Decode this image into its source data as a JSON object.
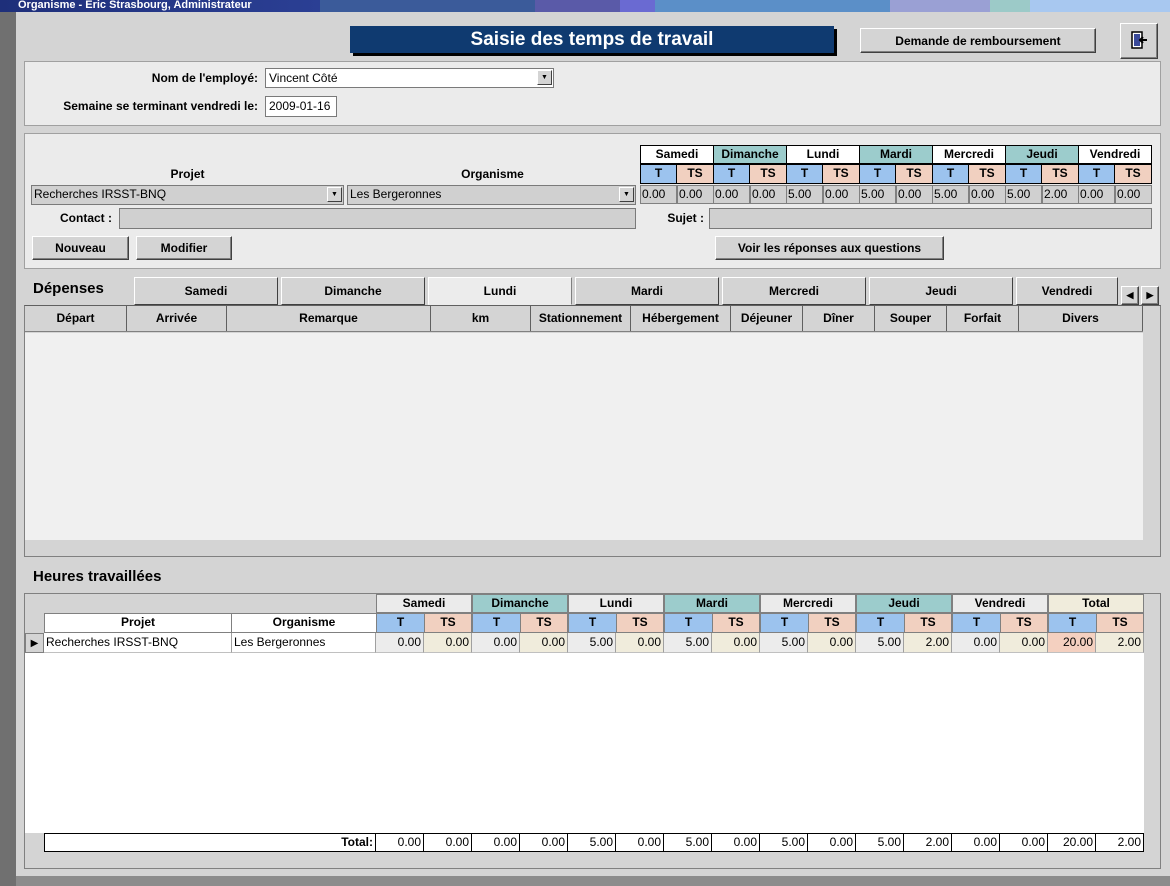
{
  "window": {
    "title": "Organisme - Eric Strasbourg, Administrateur"
  },
  "header": {
    "form_title": "Saisie des temps de travail",
    "reimburse_button": "Demande de remboursement",
    "exit_icon": "exit-door-icon"
  },
  "employee": {
    "label": "Nom de l'employé:",
    "value": "Vincent Côté",
    "week_label": "Semaine se terminant vendredi le:",
    "week_value": "2009-01-16"
  },
  "entry": {
    "projet_label": "Projet",
    "organisme_label": "Organisme",
    "projet_value": "Recherches IRSST-BNQ",
    "organisme_value": "Les Bergeronnes",
    "contact_label": "Contact :",
    "sujet_label": "Sujet :",
    "nouveau_button": "Nouveau",
    "modifier_button": "Modifier",
    "questions_button": "Voir les réponses aux questions",
    "days": [
      "Samedi",
      "Dimanche",
      "Lundi",
      "Mardi",
      "Mercredi",
      "Jeudi",
      "Vendredi"
    ],
    "t_label": "T",
    "ts_label": "TS",
    "values": [
      [
        "0.00",
        "0.00"
      ],
      [
        "0.00",
        "0.00"
      ],
      [
        "5.00",
        "0.00"
      ],
      [
        "5.00",
        "0.00"
      ],
      [
        "5.00",
        "0.00"
      ],
      [
        "5.00",
        "2.00"
      ],
      [
        "0.00",
        "0.00"
      ]
    ]
  },
  "depenses": {
    "title": "Dépenses",
    "tabs": [
      "Samedi",
      "Dimanche",
      "Lundi",
      "Mardi",
      "Mercredi",
      "Jeudi",
      "Vendredi"
    ],
    "selected_tab": "Lundi",
    "columns": [
      "Départ",
      "Arrivée",
      "Remarque",
      "km",
      "Stationnement",
      "Hébergement",
      "Déjeuner",
      "Dîner",
      "Souper",
      "Forfait",
      "Divers"
    ]
  },
  "heures": {
    "title": "Heures travaillées",
    "col_projet": "Projet",
    "col_organisme": "Organisme",
    "days": [
      "Samedi",
      "Dimanche",
      "Lundi",
      "Mardi",
      "Mercredi",
      "Jeudi",
      "Vendredi",
      "Total"
    ],
    "t_label": "T",
    "ts_label": "TS",
    "rows": [
      {
        "projet": "Recherches IRSST-BNQ",
        "organisme": "Les Bergeronnes",
        "values": [
          "0.00",
          "0.00",
          "0.00",
          "0.00",
          "5.00",
          "0.00",
          "5.00",
          "0.00",
          "5.00",
          "0.00",
          "5.00",
          "2.00",
          "0.00",
          "0.00",
          "20.00",
          "2.00"
        ]
      }
    ],
    "total_label": "Total:",
    "totals": [
      "0.00",
      "0.00",
      "0.00",
      "0.00",
      "5.00",
      "0.00",
      "5.00",
      "0.00",
      "5.00",
      "0.00",
      "5.00",
      "2.00",
      "0.00",
      "0.00",
      "20.00",
      "2.00"
    ]
  },
  "colors": {
    "title_bg": "#0f3a70",
    "t_blue": "#9cc3ee",
    "ts_salmon": "#f1d0c0",
    "teal": "#9ccccc",
    "cream": "#f0ecdc"
  }
}
